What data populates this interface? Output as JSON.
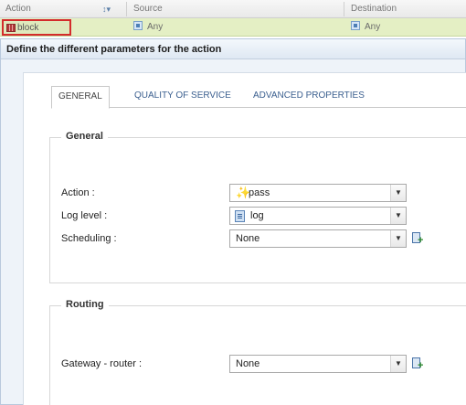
{
  "grid": {
    "columns": [
      "Action",
      "Source",
      "Destination"
    ],
    "row": {
      "action": "block",
      "source": "Any",
      "destination": "Any"
    }
  },
  "dialog": {
    "title": "Define the different parameters for the action",
    "tabs": [
      {
        "label": "GENERAL",
        "active": true
      },
      {
        "label": "QUALITY OF SERVICE",
        "active": false
      },
      {
        "label": "ADVANCED PROPERTIES",
        "active": false
      }
    ],
    "general": {
      "legend": "General",
      "fields": [
        {
          "label": "Action :",
          "value": "pass",
          "icon": "pass-icon"
        },
        {
          "label": "Log level :",
          "value": "log",
          "icon": "log-icon"
        },
        {
          "label": "Scheduling :",
          "value": "None"
        }
      ]
    },
    "routing": {
      "legend": "Routing",
      "fields": [
        {
          "label": "Gateway - router :",
          "value": "None"
        }
      ]
    }
  },
  "colors": {
    "row_highlight": "#e4efc4",
    "selection_border": "#d42c2c",
    "tab_link": "#3b5f8f"
  }
}
